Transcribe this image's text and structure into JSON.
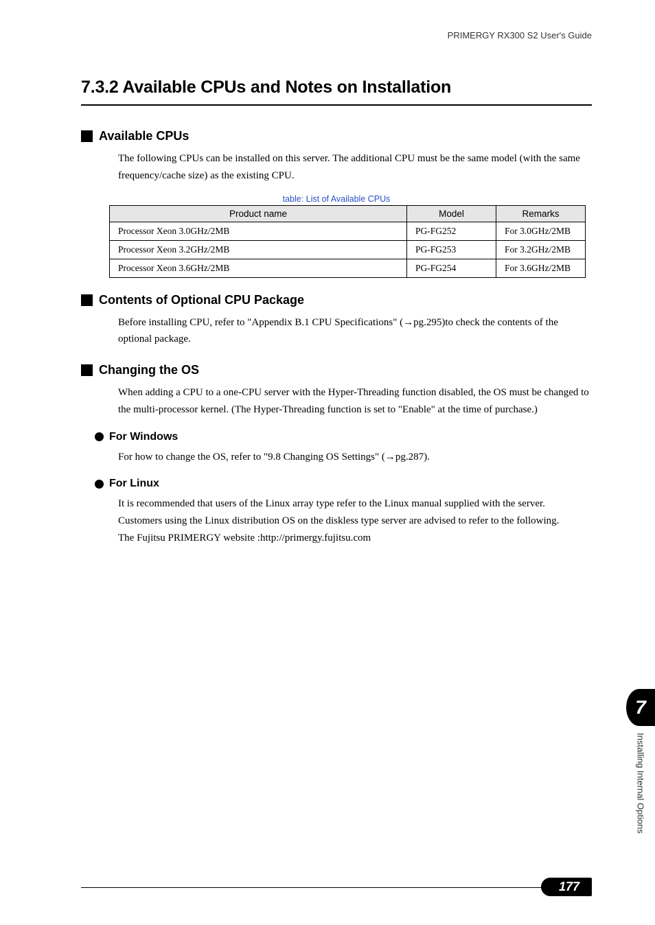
{
  "running_header": "PRIMERGY RX300 S2 User's Guide",
  "h1": "7.3.2  Available CPUs and Notes on Installation",
  "sections": {
    "available_cpus": {
      "title": "Available CPUs",
      "para": "The following CPUs can be installed on this server. The additional CPU must be the same model (with the same frequency/cache size) as the existing CPU.",
      "table_caption": "table: List of Available CPUs"
    },
    "optional_pkg": {
      "title": "Contents of Optional CPU Package",
      "para": "Before installing CPU, refer to \"Appendix B.1 CPU Specifications\" (→pg.295)to check the contents of the optional package."
    },
    "changing_os": {
      "title": "Changing the OS",
      "para": "When adding a CPU to a one-CPU server with the Hyper-Threading function disabled, the OS must be changed to the multi-processor kernel. (The Hyper-Threading function is set to \"Enable\" at the time of purchase.)",
      "windows": {
        "title": "For Windows",
        "para": "For how to change the OS, refer to \"9.8 Changing OS Settings\" (→pg.287)."
      },
      "linux": {
        "title": "For Linux",
        "para1": "It is recommended that users of the Linux array type refer to the Linux manual supplied with the server. Customers using the Linux distribution OS on the diskless type server are advised to refer to the following.",
        "para2": "The Fujitsu PRIMERGY website :http://primergy.fujitsu.com"
      }
    }
  },
  "chart_data": {
    "type": "table",
    "title": "table: List of Available CPUs",
    "headers": [
      "Product name",
      "Model",
      "Remarks"
    ],
    "rows": [
      {
        "product": "Processor Xeon 3.0GHz/2MB",
        "model": "PG-FG252",
        "remarks": "For 3.0GHz/2MB"
      },
      {
        "product": "Processor Xeon 3.2GHz/2MB",
        "model": "PG-FG253",
        "remarks": "For 3.2GHz/2MB"
      },
      {
        "product": "Processor Xeon 3.6GHz/2MB",
        "model": "PG-FG254",
        "remarks": "For 3.6GHz/2MB"
      }
    ]
  },
  "side_tab": {
    "number": "7",
    "label": "Installing Internal Options"
  },
  "page_number": "177"
}
